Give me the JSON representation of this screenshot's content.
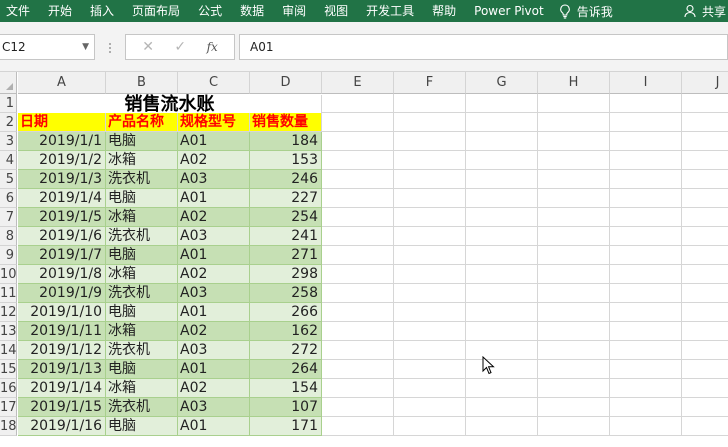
{
  "ribbon": {
    "tabs": [
      "文件",
      "开始",
      "插入",
      "页面布局",
      "公式",
      "数据",
      "审阅",
      "视图",
      "开发工具",
      "帮助",
      "Power Pivot"
    ],
    "tell_me": "告诉我",
    "share": "共享"
  },
  "formula_bar": {
    "name_box": "C12",
    "content": "A01",
    "fx_label": "fx"
  },
  "columns": [
    "A",
    "B",
    "C",
    "D",
    "E",
    "F",
    "G",
    "H",
    "I",
    "J"
  ],
  "row_numbers": [
    "1",
    "2",
    "3",
    "4",
    "5",
    "6",
    "7",
    "8",
    "9",
    "10",
    "11",
    "12",
    "13",
    "14",
    "15",
    "16",
    "17",
    "18"
  ],
  "sheet": {
    "title": "销售流水账",
    "headers": [
      "日期",
      "产品名称",
      "规格型号",
      "销售数量"
    ],
    "rows": [
      [
        "2019/1/1",
        "电脑",
        "A01",
        "184"
      ],
      [
        "2019/1/2",
        "冰箱",
        "A02",
        "153"
      ],
      [
        "2019/1/3",
        "洗衣机",
        "A03",
        "246"
      ],
      [
        "2019/1/4",
        "电脑",
        "A01",
        "227"
      ],
      [
        "2019/1/5",
        "冰箱",
        "A02",
        "254"
      ],
      [
        "2019/1/6",
        "洗衣机",
        "A03",
        "241"
      ],
      [
        "2019/1/7",
        "电脑",
        "A01",
        "271"
      ],
      [
        "2019/1/8",
        "冰箱",
        "A02",
        "298"
      ],
      [
        "2019/1/9",
        "洗衣机",
        "A03",
        "258"
      ],
      [
        "2019/1/10",
        "电脑",
        "A01",
        "266"
      ],
      [
        "2019/1/11",
        "冰箱",
        "A02",
        "162"
      ],
      [
        "2019/1/12",
        "洗衣机",
        "A03",
        "272"
      ],
      [
        "2019/1/13",
        "电脑",
        "A01",
        "264"
      ],
      [
        "2019/1/14",
        "冰箱",
        "A02",
        "154"
      ],
      [
        "2019/1/15",
        "洗衣机",
        "A03",
        "107"
      ],
      [
        "2019/1/16",
        "电脑",
        "A01",
        "171"
      ]
    ]
  },
  "colors": {
    "ribbon": "#217346",
    "band_dark": "#c6e0b4",
    "band_light": "#e2efda",
    "header_fill": "#ffff00",
    "header_text": "#ff0000"
  }
}
